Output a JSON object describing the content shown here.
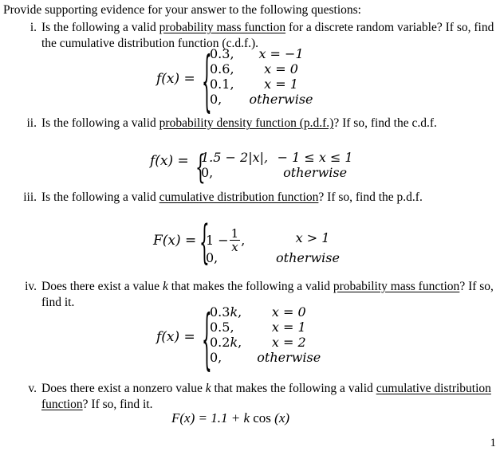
{
  "document": {
    "intro": "Provide supporting evidence for your answer to the following questions:",
    "page_number": "1"
  },
  "items": [
    {
      "marker": "i.",
      "text_before_underline": "Is the following a valid ",
      "underlined": "probability mass function",
      "text_after_underline": " for a discrete random variable?  If so, find the cumulative distribution function (c.d.f.).",
      "formula": {
        "lhs": "f(x) =",
        "cases": [
          {
            "value": "0.3,",
            "condition": "x = −1"
          },
          {
            "value": "0.6,",
            "condition": "x = 0"
          },
          {
            "value": "0.1,",
            "condition": "x = 1"
          },
          {
            "value": "0,",
            "condition": "otherwise"
          }
        ]
      }
    },
    {
      "marker": "ii.",
      "text_before_underline": "Is the following a valid ",
      "underlined": "probability density function (p.d.f.)",
      "text_after_underline": "?  If so, find the c.d.f.",
      "formula": {
        "lhs": "f(x) =",
        "cases": [
          {
            "value": "1.5 − 2|x|,",
            "condition": "− 1 ≤ x ≤ 1"
          },
          {
            "value": "0,",
            "condition": "otherwise"
          }
        ]
      }
    },
    {
      "marker": "iii.",
      "text_before_underline": "Is the following a valid ",
      "underlined": "cumulative distribution function",
      "text_after_underline": "?  If so, find the p.d.f.",
      "formula": {
        "lhs": "F(x) =",
        "cases": [
          {
            "value": "1 − 1/x ,",
            "numerator": "1",
            "denominator": "x",
            "condition": "x > 1"
          },
          {
            "value": "0,",
            "condition": "otherwise"
          }
        ]
      }
    },
    {
      "marker": "iv.",
      "text_before_underline": "Does there exist a value k that makes the following a valid ",
      "underlined": "probability mass function",
      "text_after_underline": "?  If so, find it.",
      "formula": {
        "lhs": "f(x) =",
        "cases": [
          {
            "value": "0.3k,",
            "condition": "x = 0"
          },
          {
            "value": "0.5,",
            "condition": "x = 1"
          },
          {
            "value": "0.2k,",
            "condition": "x = 2"
          },
          {
            "value": "0,",
            "condition": "otherwise"
          }
        ]
      }
    },
    {
      "marker": "v.",
      "text_before_underline": "Does there exist a nonzero value k that makes the following a valid ",
      "underlined": "cumulative distribution function",
      "text_after_underline": "?  If so, find it.",
      "equation": "F(x) = 1.1 + k cos (x)"
    }
  ],
  "math_parts": {
    "item1_lhs": "f(x) =",
    "item2_lhs": "f(x) =",
    "item3_lhs": "F(x) =",
    "item4_lhs": "f(x) =",
    "item3_frac_num": "1",
    "item3_frac_den": "x",
    "item3_one_minus": "1 −",
    "item3_comma": ",",
    "item5_eq_F": "F(x) = 1.1 + ",
    "item5_eq_k": "k",
    "item5_eq_cos": " cos ",
    "item5_eq_arg": "(x)"
  }
}
